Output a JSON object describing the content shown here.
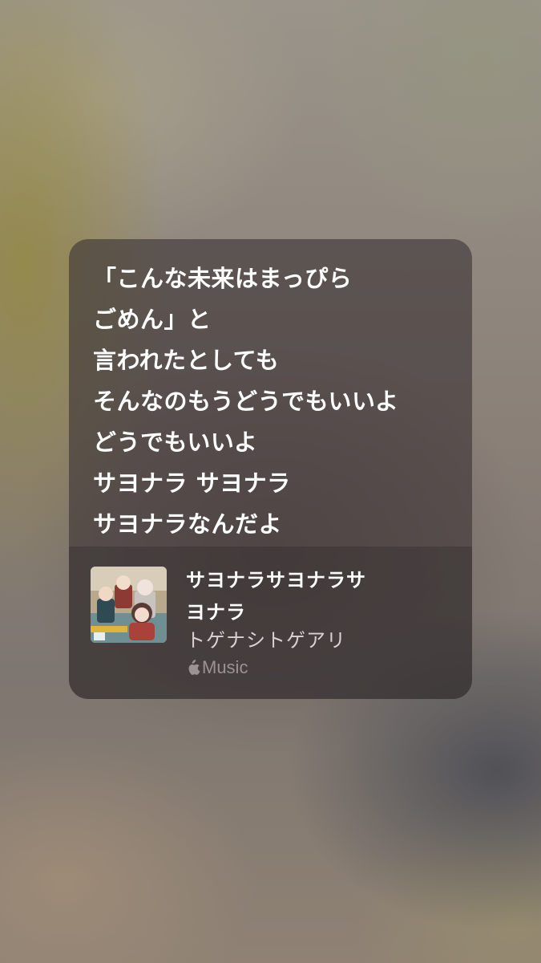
{
  "lyrics": {
    "lines": [
      "「こんな未来はまっぴら",
      "ごめん」と",
      "言われたとしても",
      "そんなのもうどうでもいいよ",
      "どうでもいいよ",
      "サヨナラ サヨナラ",
      "サヨナラなんだよ"
    ]
  },
  "track": {
    "title_line1": "サヨナラサヨナラサ",
    "title_line2": "ヨナラ",
    "artist": "トゲナシトゲアリ",
    "service_label": "Music",
    "service_icon": "apple-logo-icon",
    "artwork_icon": "album-artwork"
  }
}
